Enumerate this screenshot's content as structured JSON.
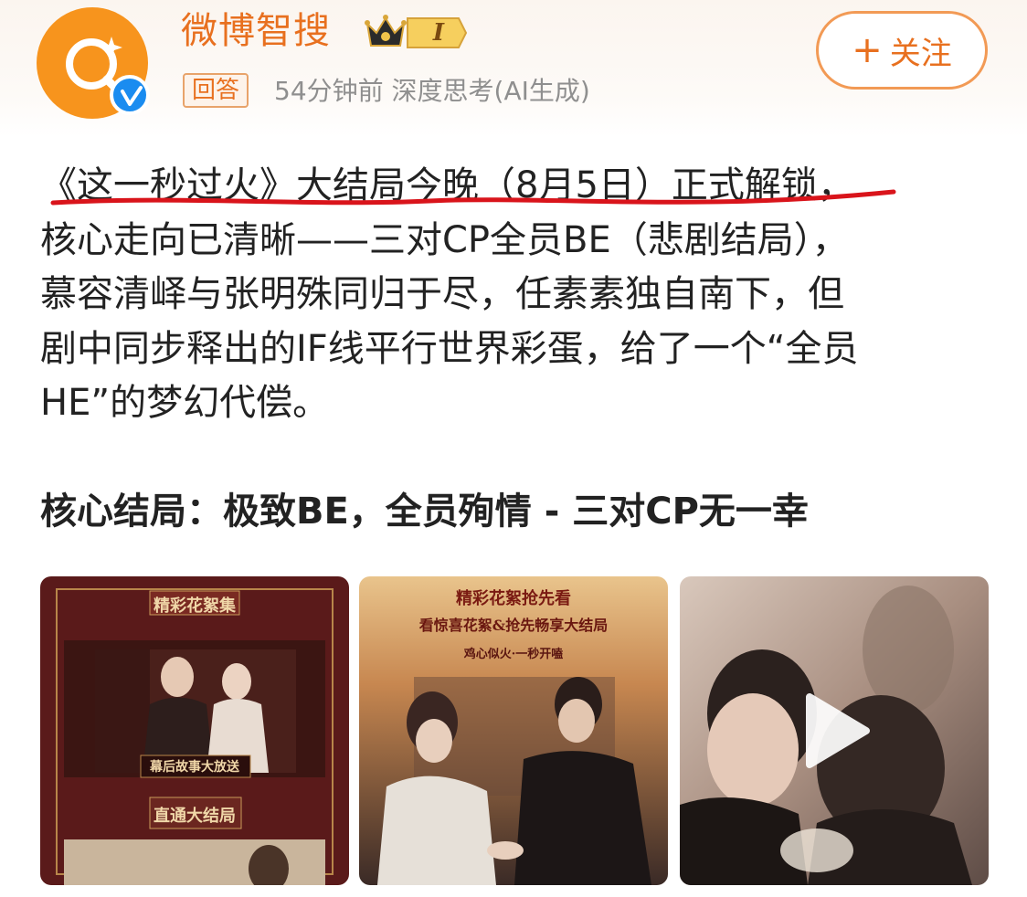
{
  "header": {
    "username": "微博智搜",
    "vip_level": "I",
    "answer_tag": "回答",
    "meta": "54分钟前 深度思考(AI生成)",
    "follow_label": "关注",
    "follow_plus": "+"
  },
  "icons": {
    "avatar": "weibo-search-logo-icon",
    "verified": "verified-check-icon",
    "crown": "vip-crown-icon",
    "play": "play-icon"
  },
  "colors": {
    "brand_orange": "#e8701f",
    "avatar_bg": "#f7941d",
    "verified_blue": "#1a8cf0",
    "annotation_red": "#d9141b"
  },
  "post": {
    "lines": [
      "《这一秒过火》大结局今晚（8月5日）正式解锁，",
      "核心走向已清晰——三对CP全员BE（悲剧结局），",
      "慕容清峄与张明殊同归于尽，任素素独自南下，但",
      "剧中同步释出的IF线平行世界彩蛋，给了一个“全员",
      "HE”的梦幻代偿。"
    ],
    "heading": "核心结局：极致BE，全员殉情 - 三对CP无一幸"
  },
  "images": [
    {
      "name": "behind-the-scenes-poster",
      "title": "精彩花絮集",
      "caption": "幕后故事大放送",
      "footer": "直通大结局"
    },
    {
      "name": "finale-poster",
      "top": "精彩花絮抢先看",
      "title": "看惊喜花絮&抢先畅享大结局",
      "subtitle": "鸡心似火·一秒开嗑"
    },
    {
      "name": "video-thumbnail"
    }
  ]
}
